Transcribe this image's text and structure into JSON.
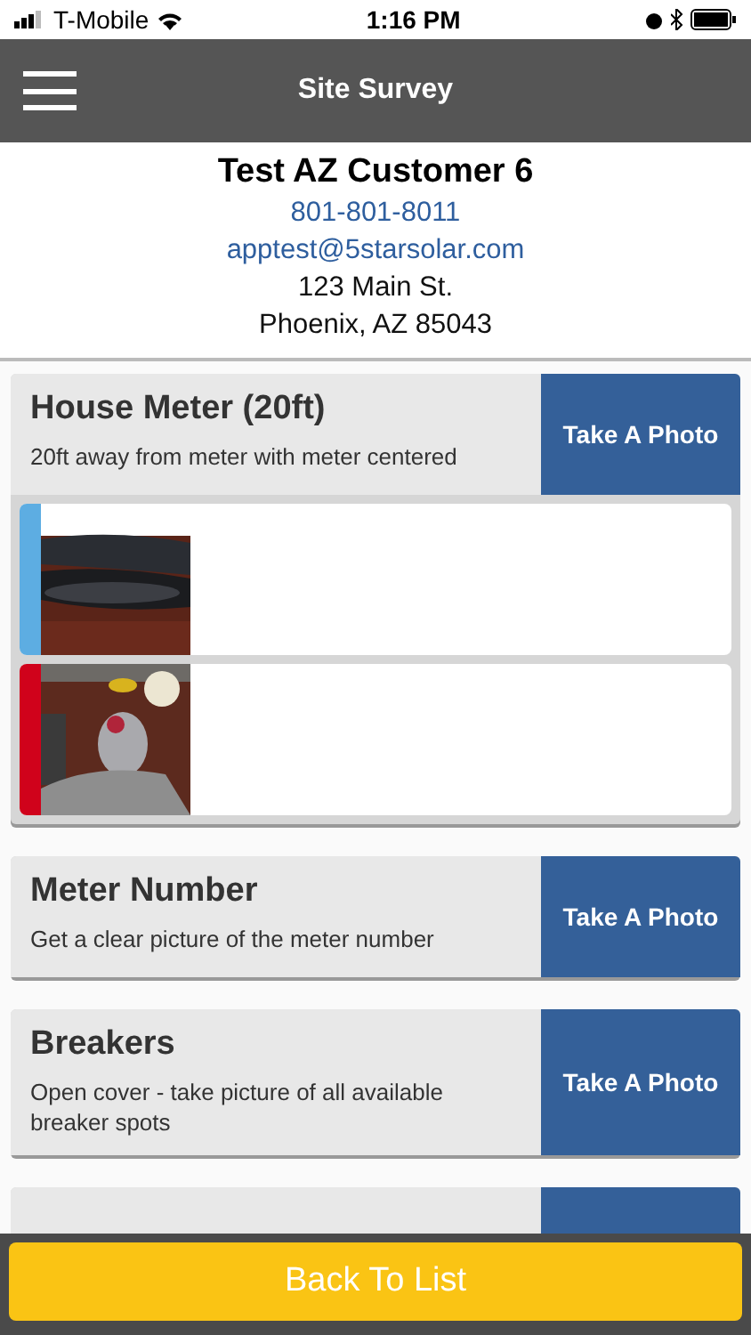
{
  "status_bar": {
    "carrier": "T-Mobile",
    "time": "1:16 PM"
  },
  "header": {
    "title": "Site Survey"
  },
  "customer": {
    "name": "Test AZ Customer 6",
    "phone": "801-801-8011",
    "email": "apptest@5starsolar.com",
    "street": "123 Main St.",
    "city": "Phoenix, AZ 85043"
  },
  "sections": [
    {
      "title": "House Meter (20ft)",
      "description": "20ft away from meter with meter centered",
      "button": "Take A Photo"
    },
    {
      "title": "Meter Number",
      "description": "Get a clear picture of the meter number",
      "button": "Take A Photo"
    },
    {
      "title": "Breakers",
      "description": "Open cover - take picture of all available breaker spots",
      "button": "Take A Photo"
    },
    {
      "kind": "cut_off"
    }
  ],
  "footer": {
    "button": "Back To List"
  }
}
